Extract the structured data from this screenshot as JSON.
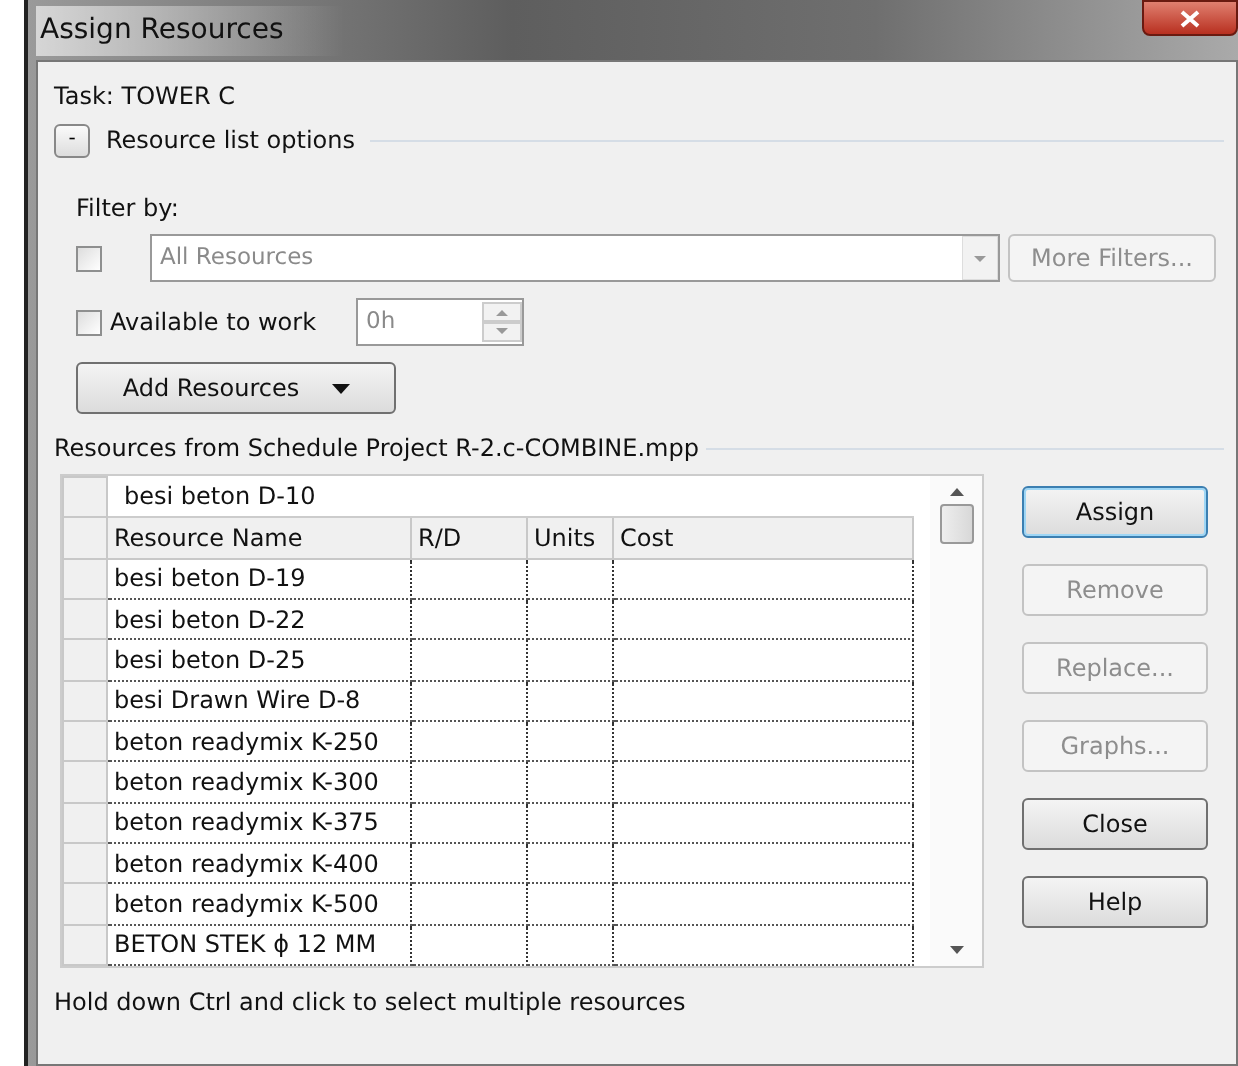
{
  "window": {
    "title": "Assign Resources"
  },
  "task": "Task: TOWER C",
  "options_toggle": {
    "symbol": "-",
    "label": "Resource list options",
    "expanded": true
  },
  "filter": {
    "label": "Filter by:",
    "checked": false,
    "value": "All Resources",
    "disabled": true,
    "more_filters": {
      "label": "More Filters...",
      "disabled": true
    }
  },
  "available": {
    "label": "Available to work",
    "checked": false,
    "value": "0h",
    "disabled": true
  },
  "add_resources": {
    "label": "Add Resources"
  },
  "list_heading": "Resources from Schedule Project R-2.c-COMBINE.mpp",
  "table": {
    "edit_value": "besi beton D-10",
    "columns": [
      "Resource Name",
      "R/D",
      "Units",
      "Cost"
    ],
    "rows": [
      {
        "name": "besi beton D-19"
      },
      {
        "name": "besi beton D-22"
      },
      {
        "name": "besi beton D-25"
      },
      {
        "name": "besi Drawn Wire D-8"
      },
      {
        "name": "beton readymix K-250"
      },
      {
        "name": "beton readymix K-300"
      },
      {
        "name": "beton readymix K-375"
      },
      {
        "name": "beton readymix K-400"
      },
      {
        "name": "beton readymix K-500"
      },
      {
        "name": "BETON STEK ϕ 12 MM"
      }
    ]
  },
  "buttons": [
    {
      "label": "Assign",
      "disabled": false,
      "default": true
    },
    {
      "label": "Remove",
      "disabled": true,
      "default": false
    },
    {
      "label": "Replace...",
      "disabled": true,
      "default": false
    },
    {
      "label": "Graphs...",
      "disabled": true,
      "default": false
    },
    {
      "label": "Close",
      "disabled": false,
      "default": false
    },
    {
      "label": "Help",
      "disabled": false,
      "default": false
    }
  ],
  "status": "Hold down Ctrl and click to select multiple resources"
}
